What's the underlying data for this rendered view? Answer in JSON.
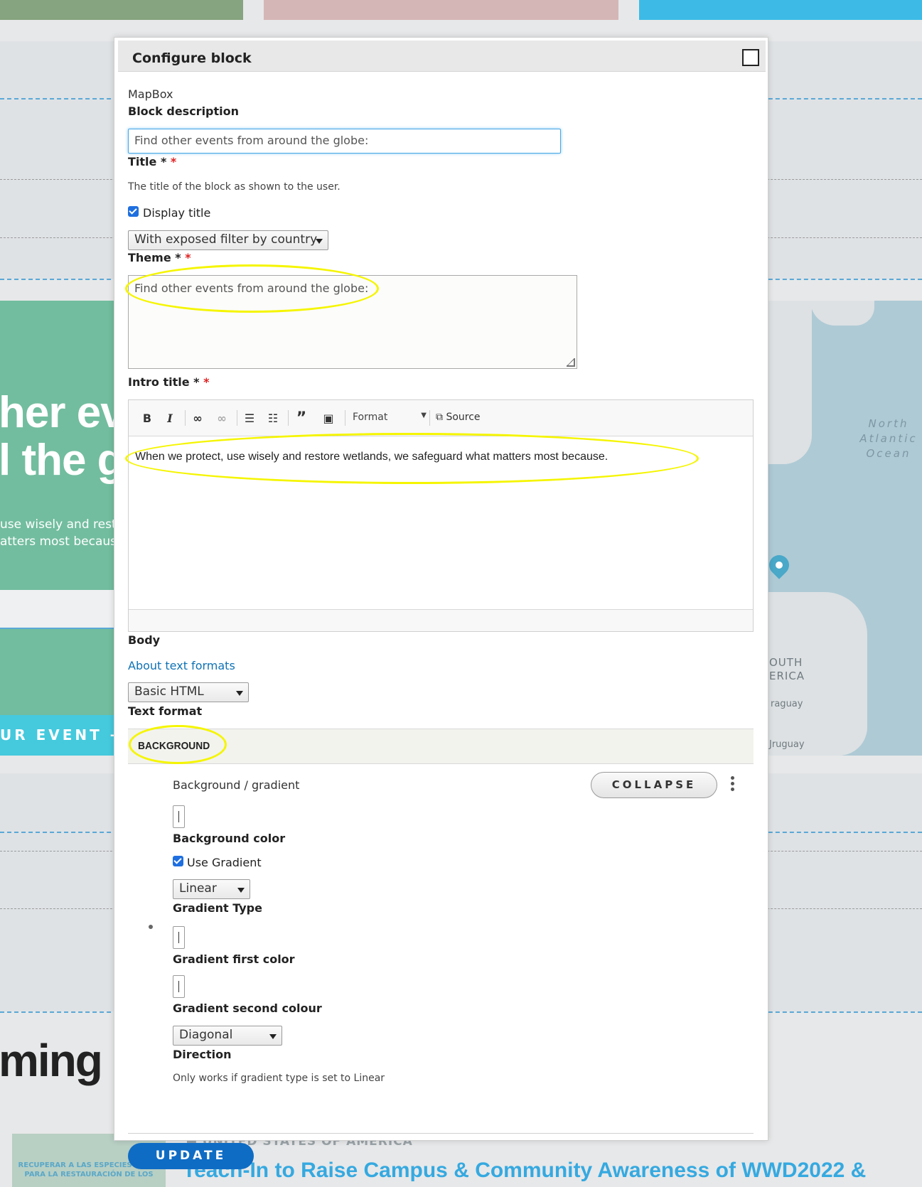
{
  "colors": {
    "tile_green": "#86a47f",
    "tile_pink": "#d5b6b6",
    "tile_blue": "#3dbbe6",
    "hero_green": "#72bd9f",
    "cta_blue": "#45c9dd",
    "map_water": "#aecad5",
    "annotation_yellow": "#f5f500",
    "primary_button": "#0f6cc4",
    "link": "#0f72b5"
  },
  "background_page": {
    "hero_heading_line1": "her eve",
    "hero_heading_line2": "l the glo",
    "hero_text_line1": "use wisely and reste",
    "hero_text_line2": "atters most becaus",
    "hero_cta": "UR EVENT →",
    "map_ocean_label": "North\nAtlantic\nOcean",
    "map_label_south_america": "OUTH\nERICA",
    "map_label_paraguay": "raguay",
    "map_label_uruguay": "Jruguay",
    "upcoming_heading": "ming Ev",
    "event_image_text": "RECUPERAR A LAS ESPECIES CLAVE PARA LA RESTAURACIÓN DE LOS",
    "event_country": "UNITED STATES OF AMERICA",
    "event_title": "Teach-In to Raise Campus & Community Awareness of WWD2022 &"
  },
  "dialog": {
    "title": "Configure block",
    "block_type": "MapBox",
    "block_description_label": "Block description",
    "title_input_value": "Find other events from around the globe:",
    "title_label": "Title *",
    "title_help": "The title of the block as shown to the user.",
    "display_title_label": "Display title",
    "theme_select_value": "With exposed filter by country",
    "theme_label": "Theme *",
    "intro_title_value": "Find other events from around the globe:",
    "intro_title_label": "Intro title *",
    "toolbar": {
      "bold": "B",
      "italic": "I",
      "format_label": "Format",
      "source_label": "Source"
    },
    "body_text": "When we protect, use wisely and restore wetlands, we safeguard what matters most because.",
    "body_label": "Body",
    "about_text_formats": "About text formats",
    "text_format_value": "Basic HTML",
    "text_format_label": "Text format",
    "background_section_title": "BACKGROUND",
    "background_breadcrumb": "Background / gradient",
    "collapse_button": "COLLAPSE",
    "background_color_label": "Background color",
    "use_gradient_label": "Use Gradient",
    "gradient_type_value": "Linear",
    "gradient_type_label": "Gradient Type",
    "gradient_first_color_label": "Gradient first color",
    "gradient_second_colour_label": "Gradient second colour",
    "direction_value": "Diagonal",
    "direction_label": "Direction",
    "direction_help": "Only works if gradient type is set to Linear",
    "update_button": "UPDATE"
  },
  "icons": [
    "close-icon",
    "bold-icon",
    "italic-icon",
    "link-icon",
    "unlink-icon",
    "bulleted-list-icon",
    "numbered-list-icon",
    "blockquote-icon",
    "image-icon",
    "source-icon",
    "kebab-menu-icon",
    "map-pin-icon",
    "location-pin-icon",
    "arrow-right-icon"
  ]
}
